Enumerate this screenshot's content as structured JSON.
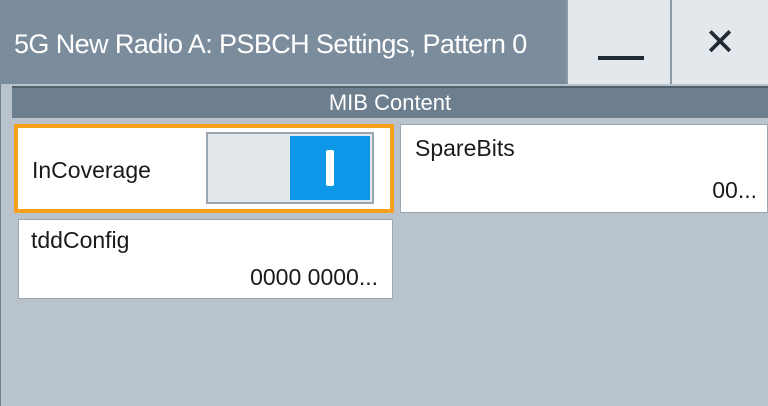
{
  "window": {
    "title": "5G New Radio A: PSBCH Settings, Pattern 0",
    "close_glyph": "✕"
  },
  "section": {
    "header": "MIB Content"
  },
  "fields": {
    "incoverage": {
      "label": "InCoverage",
      "state": "on"
    },
    "sparebits": {
      "label": "SpareBits",
      "value": "00..."
    },
    "tddconfig": {
      "label": "tddConfig",
      "value": "0000 0000..."
    }
  },
  "colors": {
    "titlebar": "#7b8d9c",
    "section_header": "#6d7f8e",
    "focus_border": "#f7a11a",
    "toggle_on": "#0c97e8",
    "background": "#b9c3cb"
  },
  "icons": {
    "minimize": "minimize-icon",
    "close": "close-icon",
    "toggle_on_mark": "toggle-on-icon"
  }
}
